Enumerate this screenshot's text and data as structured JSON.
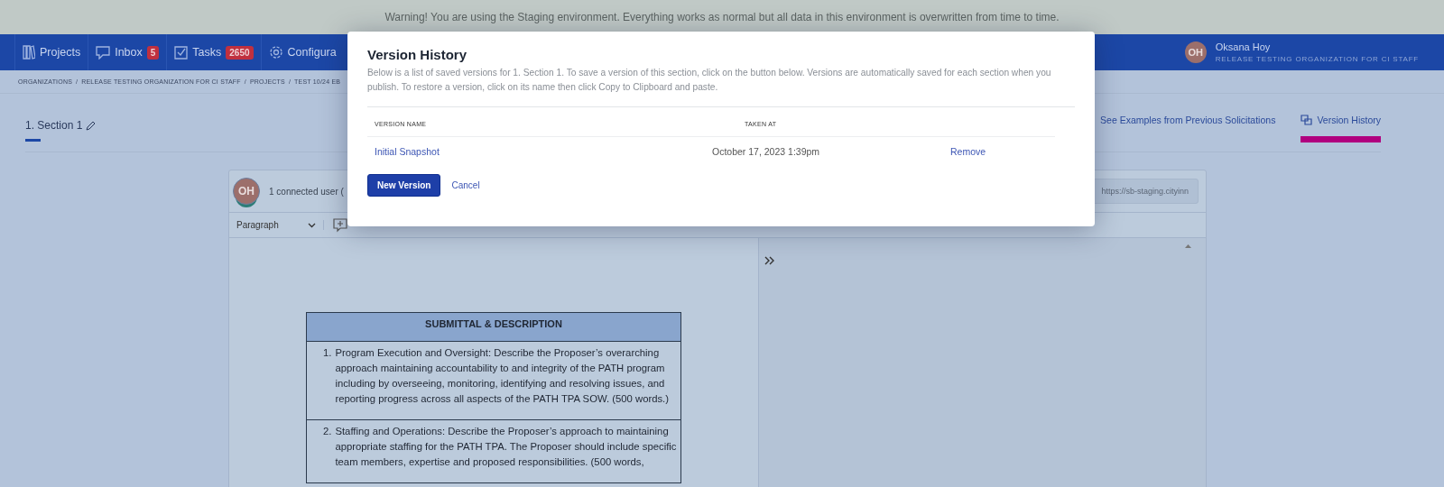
{
  "warning_banner": "Warning! You are using the Staging environment. Everything works as normal but all data in this environment is overwritten from time to time.",
  "nav": {
    "items": [
      {
        "kind": "projects",
        "label": "Projects"
      },
      {
        "kind": "inbox",
        "label": "Inbox",
        "badge": "5"
      },
      {
        "kind": "tasks",
        "label": "Tasks",
        "badge": "2650"
      },
      {
        "kind": "settings",
        "label": "Configura"
      }
    ]
  },
  "user": {
    "initials": "OH",
    "name": "Oksana Hoy",
    "organization": "RELEASE TESTING ORGANIZATION FOR CI STAFF"
  },
  "breadcrumb": {
    "separator": "/",
    "items": [
      "ORGANIZATIONS",
      "RELEASE TESTING ORGANIZATION FOR CI STAFF",
      "PROJECTS",
      "TEST 10/24 EB"
    ]
  },
  "tabs": [
    {
      "label": "1. Section 1",
      "selected": true
    }
  ],
  "links": [
    {
      "kind": "examples",
      "label": "See Examples from Previous Solicitations",
      "selected": false
    },
    {
      "kind": "history",
      "label": "Version History",
      "selected": true
    }
  ],
  "editor": {
    "avatar": "OH",
    "connected_users": "1 connected user (",
    "share_url": "https://sb-staging.cityinn",
    "block_style": "Paragraph"
  },
  "document": {
    "table_header": "SUBMITTAL & DESCRIPTION",
    "items": [
      {
        "number": "1.",
        "text": "Program Execution and Oversight: Describe the Proposer’s overarching approach maintaining accountability to and integrity of the PATH program including by overseeing, monitoring, identifying and resolving issues, and reporting progress across all aspects of the PATH TPA SOW. (500 words.)"
      },
      {
        "number": "2.",
        "text": "Staffing and Operations: Describe the Proposer’s approach to maintaining appropriate staffing for the PATH TPA.  The Proposer should include specific team members, expertise and proposed responsibilities. (500 words,"
      }
    ]
  },
  "modal": {
    "title": "Version History",
    "description": "Below is a list of saved versions for 1. Section 1. To save a version of this section, click on the button below. Versions are automatically saved for each section when you publish. To restore a version, click on its name then click Copy to Clipboard and paste.",
    "columns": [
      "VERSION NAME",
      "TAKEN AT"
    ],
    "versions": [
      {
        "name": "Initial Snapshot",
        "taken_at": "October 17, 2023 1:39pm",
        "action": "Remove"
      }
    ],
    "primary_button": "New Version",
    "cancel_button": "Cancel"
  }
}
